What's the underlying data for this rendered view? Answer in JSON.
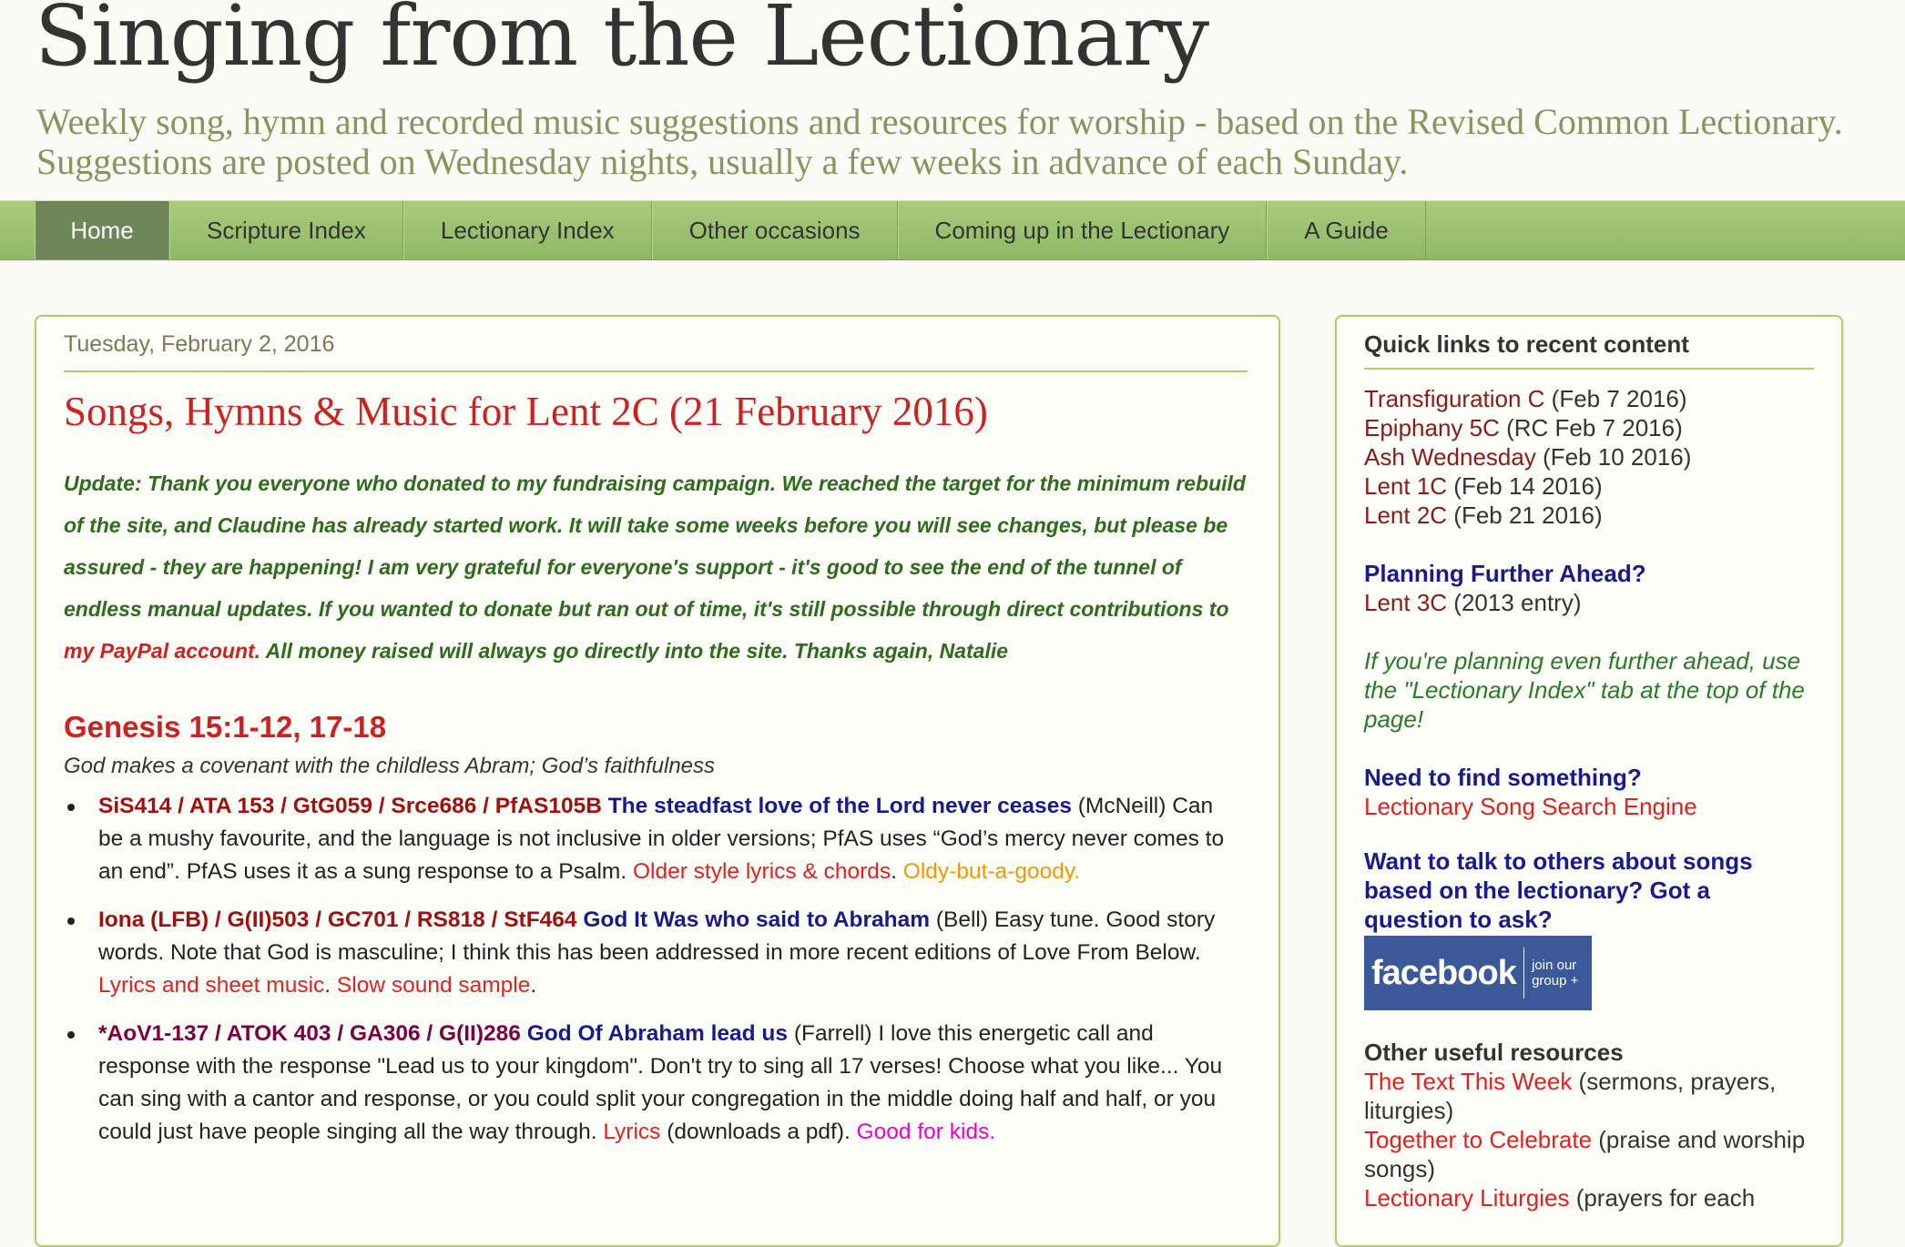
{
  "header": {
    "title": "Singing from the Lectionary",
    "description": "Weekly song, hymn and recorded music suggestions and resources for worship - based on the Revised Common Lectionary. Suggestions are posted on Wednesday nights, usually a few weeks in advance of each Sunday."
  },
  "nav": {
    "items": [
      "Home",
      "Scripture Index",
      "Lectionary Index",
      "Other occasions",
      "Coming up in the Lectionary",
      "A Guide"
    ]
  },
  "post": {
    "date": "Tuesday, February 2, 2016",
    "title": "Songs, Hymns & Music for Lent 2C (21 February 2016)",
    "update_before": "Update: Thank you everyone who donated to my fundraising campaign. We reached the target for the minimum rebuild of the site, and Claudine has already started work. It will take some weeks before you will see changes, but please be assured - they are happening! I am very grateful for everyone's support - it's good to see the end of the tunnel of endless manual updates. If you wanted to donate but ran out of time, it's still possible through direct contributions to ",
    "update_link": "my PayPal account",
    "update_after": ". All money raised will always go directly into the site. Thanks again, Natalie",
    "section_heading": "Genesis 15:1-12, 17-18",
    "section_sub": "God makes a covenant with the childless Abram; God’s faithfulness",
    "songs": [
      {
        "codes": "SiS414 / ATA 153 / GtG059 / Srce686 / PfAS105B",
        "title": "The steadfast love of the Lord never ceases",
        "desc": " (McNeill) Can be a mushy favourite, and the language is not inclusive in older versions; PfAS uses “God’s mercy never comes to an end”. PfAS uses it as a sung response to a Psalm. ",
        "link1": "Older style lyrics & chords",
        "sep1": ". ",
        "link2": "Oldy-but-a-goody."
      },
      {
        "codes": "Iona (LFB) / G(II)503 / GC701 / RS818 / StF464",
        "title": "God It Was who said to Abraham",
        "desc": " (Bell) Easy tune. Good story words. Note that God is masculine; I think this has been addressed  in more recent editions of Love From Below. ",
        "link1": "Lyrics and sheet music",
        "sep1": ". ",
        "link2": "Slow sound sample",
        "end": "."
      },
      {
        "codes": "*AoV1-137 / ATOK 403 / GA306 / G(II)286",
        "title": "God Of Abraham lead us",
        "desc": " (Farrell) I love this energetic call and response with the response \"Lead us to your kingdom\". Don't try to sing all 17 verses! Choose what you like... You can sing with a cantor and response, or you could split your congregation in the middle doing half and half, or you could just have people singing all the way through. ",
        "link1": "Lyrics",
        "sep1": " (downloads a pdf). ",
        "link2": "Good for kids."
      }
    ]
  },
  "sidebar": {
    "heading": "Quick links to recent content",
    "recent": [
      {
        "link": "Transfiguration C",
        "note": " (Feb 7 2016)"
      },
      {
        "link": "Epiphany 5C",
        "note": " (RC Feb 7 2016)"
      },
      {
        "link": "Ash Wednesday",
        "note": " (Feb 10 2016)"
      },
      {
        "link": "Lent 1C",
        "note": " (Feb 14 2016)"
      },
      {
        "link": "Lent 2C",
        "note": " (Feb 21 2016)"
      }
    ],
    "planning_heading": "Planning Further Ahead?",
    "planning_link": "Lent 3C",
    "planning_note": " (2013 entry)",
    "further_note": "If you're planning even further ahead, use the \"Lectionary Index\" tab at the top of the page!",
    "find_heading": "Need to find something?",
    "find_link": "Lectionary Song Search Engine",
    "talk_heading": "Want to talk to others about songs based on the lectionary? Got a question to ask?",
    "fb_word": "facebook",
    "fb_join": "join our group +",
    "resources_heading": "Other useful resources",
    "resources": [
      {
        "link": "The Text This Week",
        "note": " (sermons, prayers, liturgies)"
      },
      {
        "link": "Together to Celebrate",
        "note": " (praise and worship songs)"
      },
      {
        "link": "Lectionary Liturgies",
        "note": " (prayers for each"
      }
    ]
  }
}
